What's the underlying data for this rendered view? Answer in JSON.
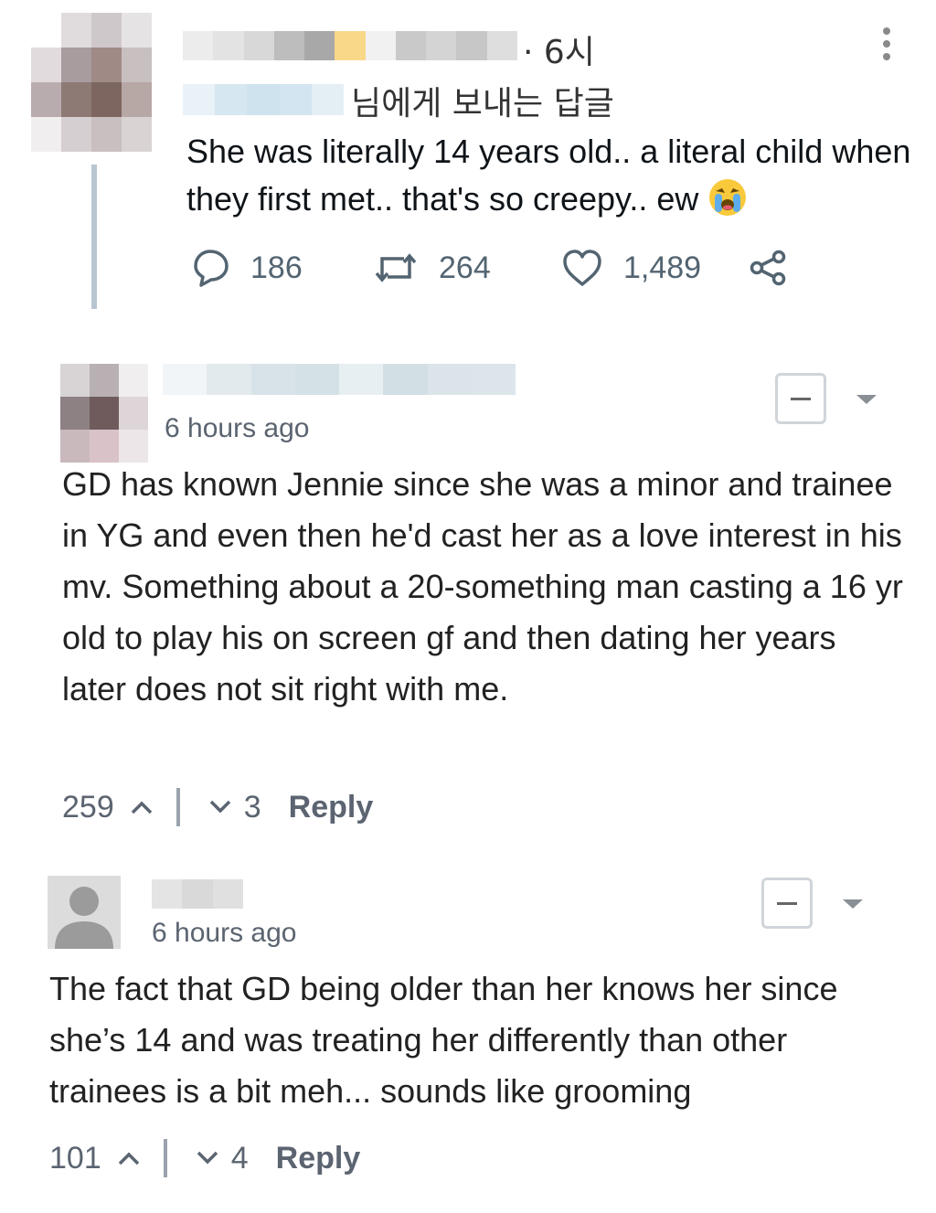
{
  "tweet": {
    "time": "· 6시",
    "reply_to": "님에게 보내는 답글",
    "text": "She was literally 14 years old.. a literal child when they first met.. that's so creepy.. ew",
    "emoji_icon": "loudly-crying-face-icon",
    "replies": "186",
    "retweets": "264",
    "likes": "1,489"
  },
  "comments": [
    {
      "time": "6 hours ago",
      "text": "GD has known Jennie since she was a minor and trainee in YG and even then he'd cast her as a love interest in his mv. Something about a 20-something man casting a 16 yr old to play his on screen gf and then dating her years later does not sit right with me.",
      "upvotes": "259",
      "downvotes": "3",
      "reply_label": "Reply"
    },
    {
      "time": "6 hours ago",
      "text": "The fact that GD being older than her knows her since she’s 14 and was treating her differently than other trainees is a bit meh... sounds like grooming",
      "upvotes": "101",
      "downvotes": "4",
      "reply_label": "Reply"
    }
  ],
  "colors": {
    "thread_line": "#b9c6d1",
    "icon_gray": "#536471",
    "blur_blue": "#cfe3ef"
  }
}
